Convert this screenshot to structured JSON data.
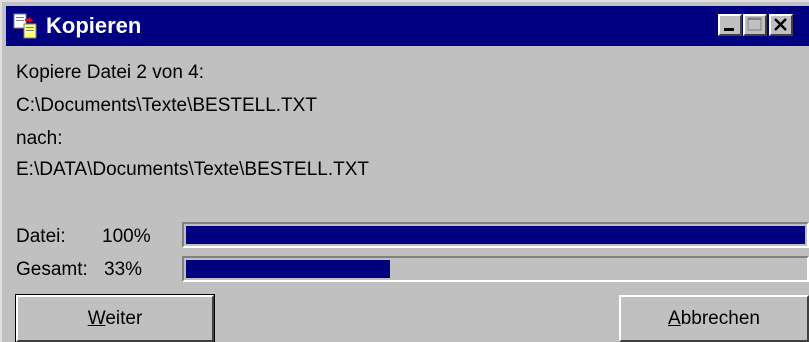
{
  "window": {
    "title": "Kopieren",
    "titlebar_color": "#000080",
    "icon": "copy-files-icon",
    "controls": [
      "minimize-icon",
      "maximize-icon",
      "close-icon"
    ]
  },
  "status": {
    "line1": "Kopiere Datei 2 von 4:",
    "source_path": "C:\\Documents\\Texte\\BESTELL.TXT",
    "to_label": "nach:",
    "dest_path": "E:\\DATA\\Documents\\Texte\\BESTELL.TXT"
  },
  "progress": {
    "file": {
      "label": "Datei:",
      "percent_text": "100%",
      "value": 1.0
    },
    "total": {
      "label": "Gesamt:",
      "percent_text": "33%",
      "value": 0.33
    },
    "fill_color": "#000080"
  },
  "buttons": {
    "next": {
      "mnemonic": "W",
      "rest": "eiter"
    },
    "cancel": {
      "mnemonic": "A",
      "rest": "bbrechen"
    }
  }
}
